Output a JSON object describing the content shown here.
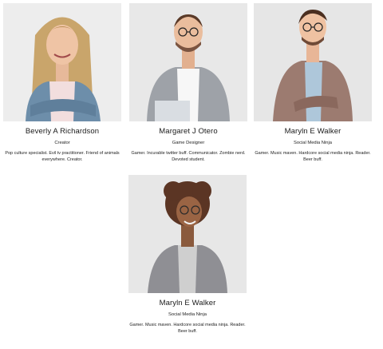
{
  "team": [
    {
      "name": "Beverly A Richardson",
      "role": "Creator",
      "bio": "Pop culture specialist. Evil tv practitioner. Friend of animals everywhere. Creator.",
      "photo_icon": "woman-portrait-icon"
    },
    {
      "name": "Margaret J Otero",
      "role": "Game Designer",
      "bio": "Gamer. Incurable twitter buff. Communicator. Zombie nerd. Devoted student.",
      "photo_icon": "man-portrait-icon"
    },
    {
      "name": "Maryln E Walker",
      "role": "Social Media Ninja",
      "bio": "Gamer. Music maven. Hardcore social media ninja. Reader. Beer buff.",
      "photo_icon": "man-portrait-icon"
    },
    {
      "name": "Maryln E Walker",
      "role": "Social Media Ninja",
      "bio": "Gamer. Music maven. Hardcore social media ninja. Reader. Beer buff.",
      "photo_icon": "woman-portrait-icon"
    }
  ],
  "colors": {
    "photo_bg": "#e9e9e9",
    "text": "#1b1b1b"
  }
}
